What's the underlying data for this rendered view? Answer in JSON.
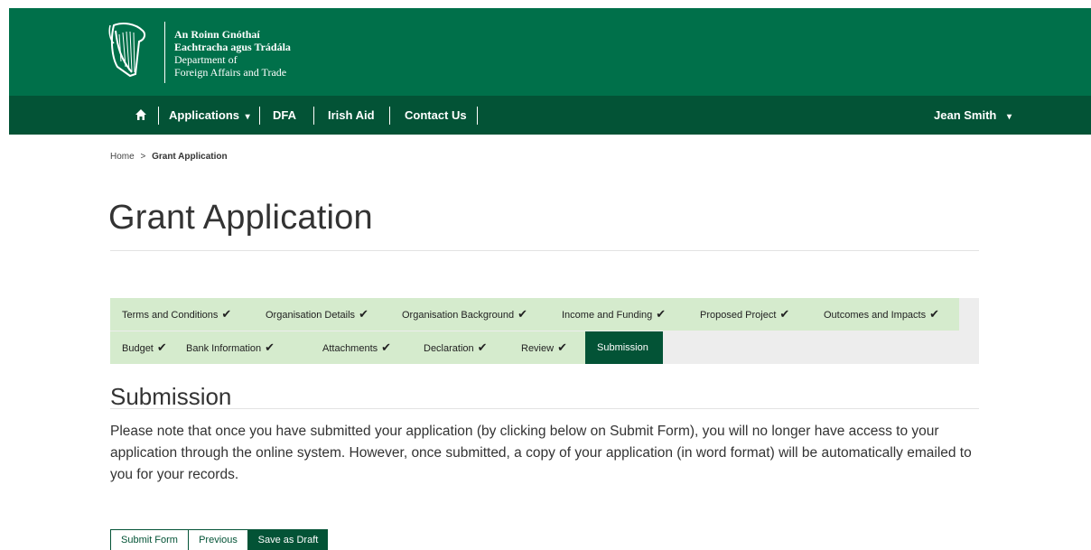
{
  "colors": {
    "brand_green": "#00704a",
    "nav_green": "#035336",
    "step_bg": "#d5ebcd",
    "step_active": "#035336"
  },
  "header": {
    "logo_icon": "harp-icon",
    "lines": [
      "An Roinn Gnóthaí",
      "Eachtracha agus Trádála",
      "Department of",
      "Foreign Affairs and Trade"
    ]
  },
  "nav": {
    "home_icon": "home-icon",
    "items": [
      {
        "label": "Applications",
        "icon": "caret-down-icon"
      },
      {
        "label": "DFA"
      },
      {
        "label": "Irish Aid"
      },
      {
        "label": "Contact Us"
      }
    ],
    "user": {
      "label": "Jean Smith",
      "icon": "caret-down-icon"
    }
  },
  "breadcrumb": {
    "home": "Home",
    "separator": ">",
    "current": "Grant Application"
  },
  "page_title": "Grant Application",
  "steps": [
    {
      "label": "Terms and Conditions",
      "done": true
    },
    {
      "label": "Organisation Details",
      "done": true
    },
    {
      "label": "Organisation Background",
      "done": true
    },
    {
      "label": "Income and Funding",
      "done": true
    },
    {
      "label": "Proposed Project",
      "done": true
    },
    {
      "label": "Outcomes and Impacts",
      "done": true
    },
    {
      "label": "Budget",
      "done": true
    },
    {
      "label": "Bank Information",
      "done": true
    },
    {
      "label": "Attachments",
      "done": true
    },
    {
      "label": "Declaration",
      "done": true
    },
    {
      "label": "Review",
      "done": true
    },
    {
      "label": "Submission",
      "done": false,
      "active": true
    }
  ],
  "check_glyph": "✔",
  "caret_glyph": "▾",
  "section": {
    "title": "Submission",
    "notice": "Please note that once you have submitted your application (by clicking below on Submit Form), you will no longer have access to your application through the online system. However, once submitted, a copy of your application (in word format) will be automatically emailed to you for your records."
  },
  "buttons": {
    "submit": "Submit Form",
    "previous": "Previous",
    "save_draft": "Save as Draft"
  }
}
